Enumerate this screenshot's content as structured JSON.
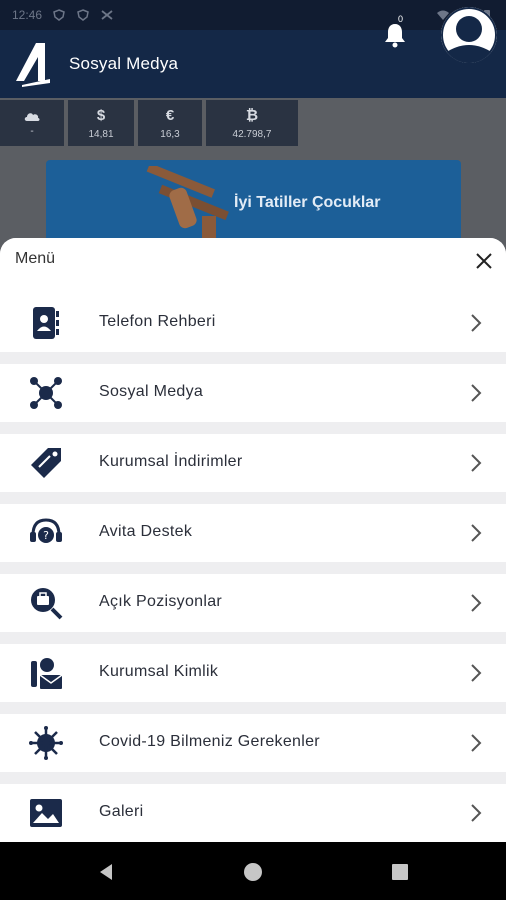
{
  "status_bar": {
    "time": "12:46"
  },
  "app_bar": {
    "title": "Sosyal Medya",
    "notification_count": "0"
  },
  "tiles": [
    {
      "icon": "cloud-icon",
      "value": "-"
    },
    {
      "symbol": "$",
      "value": "14,81"
    },
    {
      "symbol": "€",
      "value": "16,3"
    },
    {
      "symbol": "₿",
      "value": "42.798,7"
    }
  ],
  "banner": {
    "text": "İyi Tatiller Çocuklar"
  },
  "sheet": {
    "title": "Menü",
    "items": [
      {
        "label": "Telefon Rehberi",
        "icon": "phonebook-icon"
      },
      {
        "label": "Sosyal Medya",
        "icon": "social-media-icon"
      },
      {
        "label": "Kurumsal İndirimler",
        "icon": "discount-tag-icon"
      },
      {
        "label": "Avita Destek",
        "icon": "support-headset-icon"
      },
      {
        "label": "Açık Pozisyonlar",
        "icon": "job-search-icon"
      },
      {
        "label": "Kurumsal Kimlik",
        "icon": "corporate-identity-icon"
      },
      {
        "label": "Covid-19 Bilmeniz Gerekenler",
        "icon": "virus-icon"
      },
      {
        "label": "Galeri",
        "icon": "gallery-icon"
      }
    ]
  },
  "colors": {
    "app_bar": "#142847",
    "icon_navy": "#1b2a4a",
    "overlay": "#5b5e63"
  }
}
